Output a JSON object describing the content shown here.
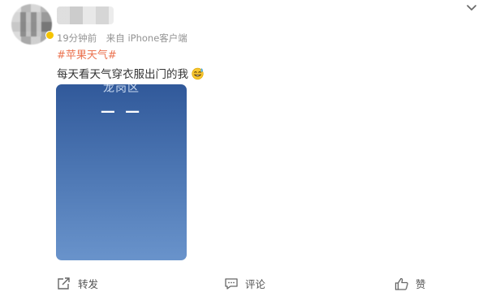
{
  "post": {
    "time": "19分钟前",
    "source": "来自 iPhone客户端",
    "hashtag": "#苹果天气#",
    "text": "每天看天气穿衣服出门的我",
    "emoji": "sweat-smile-emoji"
  },
  "weather_card": {
    "location": "龙岗区",
    "temperature": "— —"
  },
  "actions": {
    "repost": "转发",
    "comment": "评论",
    "like": "赞"
  },
  "colors": {
    "hashtag": "#eb7350",
    "meta": "#939393",
    "card_top": "#31599a",
    "card_bottom": "#6993cb"
  },
  "icons": [
    "chevron-down-icon",
    "repost-icon",
    "comment-icon",
    "like-icon"
  ]
}
